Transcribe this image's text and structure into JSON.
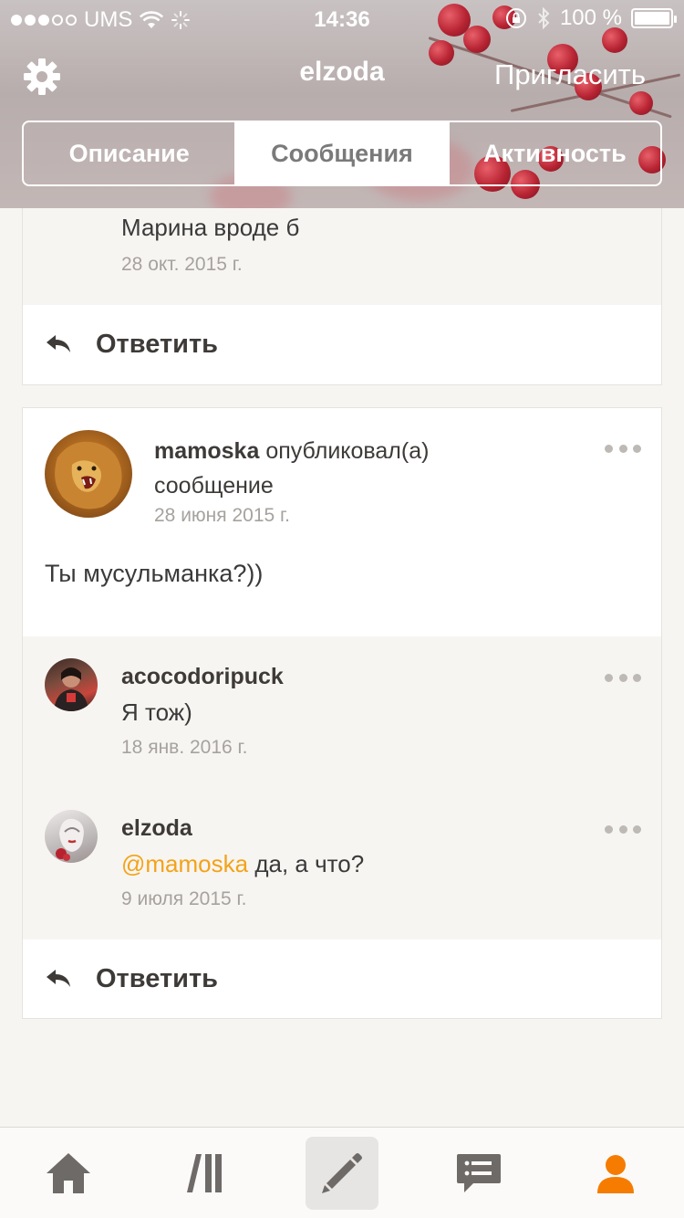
{
  "status_bar": {
    "carrier": "UMS",
    "time": "14:36",
    "battery_text": "100 %",
    "signal_bars_filled": 3,
    "signal_bars_total": 5
  },
  "nav": {
    "title": "elzoda",
    "invite_label": "Пригласить",
    "settings_icon": "gear-icon"
  },
  "tabs": [
    {
      "label": "Описание",
      "active": false
    },
    {
      "label": "Сообщения",
      "active": true
    },
    {
      "label": "Активность",
      "active": false
    }
  ],
  "thread1": {
    "last_comment_text": "Марина вроде б",
    "last_comment_date": "28 окт. 2015 г.",
    "reply_label": "Ответить"
  },
  "thread2": {
    "post": {
      "author": "mamoska",
      "action": "опубликовал(а)",
      "action_object": "сообщение",
      "date": "28 июня 2015 г.",
      "text": "Ты мусульманка?))"
    },
    "comments": [
      {
        "author": "acocodoripuck",
        "text": "Я тож)",
        "date": "18 янв. 2016 г."
      },
      {
        "author": "elzoda",
        "mention": "@mamoska",
        "text": " да, а что?",
        "date": "9 июля 2015 г."
      }
    ],
    "reply_label": "Ответить"
  },
  "tabbar": {
    "items": [
      "home-icon",
      "library-icon",
      "write-icon",
      "messages-icon",
      "profile-icon"
    ],
    "active_index": 2,
    "accent_color": "#f57c00"
  },
  "colors": {
    "mention": "#f3a318",
    "text_muted": "#a6a29e",
    "tab_accent": "#f57c00"
  }
}
